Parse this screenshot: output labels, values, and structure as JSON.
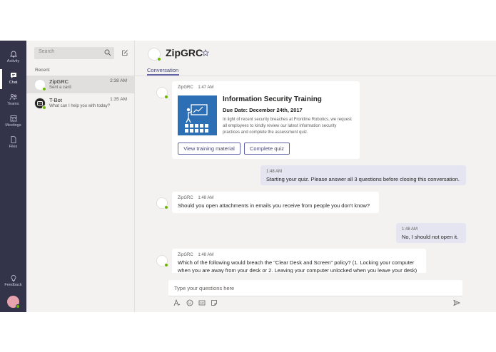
{
  "rail": {
    "items": [
      {
        "label": "Activity"
      },
      {
        "label": "Chat"
      },
      {
        "label": "Teams"
      },
      {
        "label": "Meetings"
      },
      {
        "label": "Files"
      }
    ],
    "feedback": "Feedback"
  },
  "chat_list": {
    "search_placeholder": "Search",
    "section": "Recent",
    "chats": [
      {
        "name": "ZipGRC",
        "preview": "Sent a card",
        "time": "2:38 AM"
      },
      {
        "name": "T-Bot",
        "preview": "What can I help you with today?",
        "time": "1:35 AM"
      }
    ]
  },
  "header": {
    "title": "ZipGRC",
    "tab": "Conversation",
    "avatar_text": "ZipGRC"
  },
  "messages": {
    "card": {
      "sender": "ZipGRC",
      "time": "1:47 AM",
      "title": "Information Security Training",
      "due": "Due Date: December 24th, 2017",
      "body": "In light of recent security breaches at Frontline Robotics, we request all employees to kindly review our latest information security practices and complete the assessment quiz.",
      "button1": "View training material",
      "button2": "Complete quiz"
    },
    "me1": {
      "time": "1:48 AM",
      "text": "Starting your quiz. Please answer all 3 questions before closing this conversation."
    },
    "bot1": {
      "sender": "ZipGRC",
      "time": "1:48 AM",
      "text": "Should you open attachments in emails you receive from people you don't know?"
    },
    "me2": {
      "time": "1:48 AM",
      "text": "No, I should not open it."
    },
    "bot2": {
      "sender": "ZipGRC",
      "time": "1:48 AM",
      "text1": "Which of the following would breach the \"Clear Desk and Screen\" policy? (1. Locking your computer",
      "text2": "when you are away from your desk or 2. Leaving your computer unlocked when you leave your desk)"
    }
  },
  "compose": {
    "placeholder": "Type your questions here"
  },
  "colors": {
    "rail": "#33344a",
    "accent": "#6264a7",
    "status_available": "#6bb700"
  }
}
